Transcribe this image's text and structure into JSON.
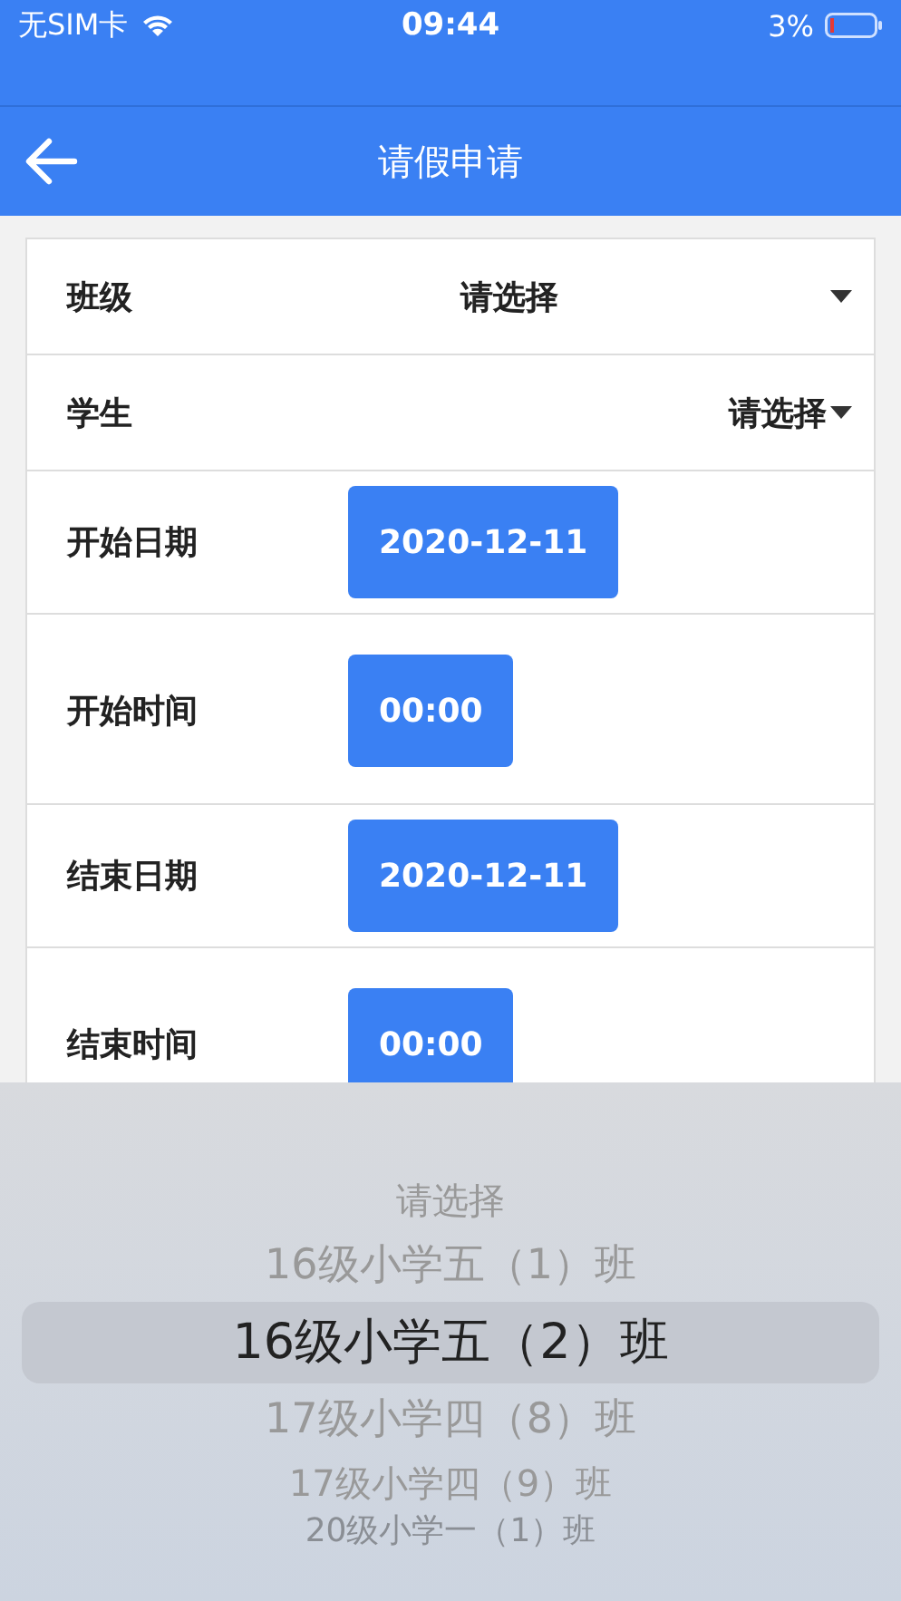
{
  "status_bar": {
    "carrier": "无SIM卡",
    "time": "09:44",
    "battery": "3%"
  },
  "nav": {
    "title": "请假申请"
  },
  "form": [
    {
      "kind": "combo",
      "label": "班级",
      "value": "请选择"
    },
    {
      "kind": "select",
      "label": "学生",
      "value": "请选择"
    },
    {
      "kind": "button",
      "label": "开始日期",
      "value": "2020-12-11"
    },
    {
      "kind": "button",
      "label": "开始时间",
      "value": "00:00"
    },
    {
      "kind": "button",
      "label": "结束日期",
      "value": "2020-12-11"
    },
    {
      "kind": "button",
      "label": "结束时间",
      "value": "00:00"
    }
  ],
  "picker": {
    "items": [
      {
        "label": "请选择",
        "selected": false
      },
      {
        "label": "16级小学五（1）班",
        "selected": false
      },
      {
        "label": "16级小学五（2）班",
        "selected": true
      },
      {
        "label": "17级小学四（8）班",
        "selected": false
      },
      {
        "label": "17级小学四（9）班",
        "selected": false
      },
      {
        "label": "20级小学一（1）班",
        "selected": false
      }
    ]
  }
}
